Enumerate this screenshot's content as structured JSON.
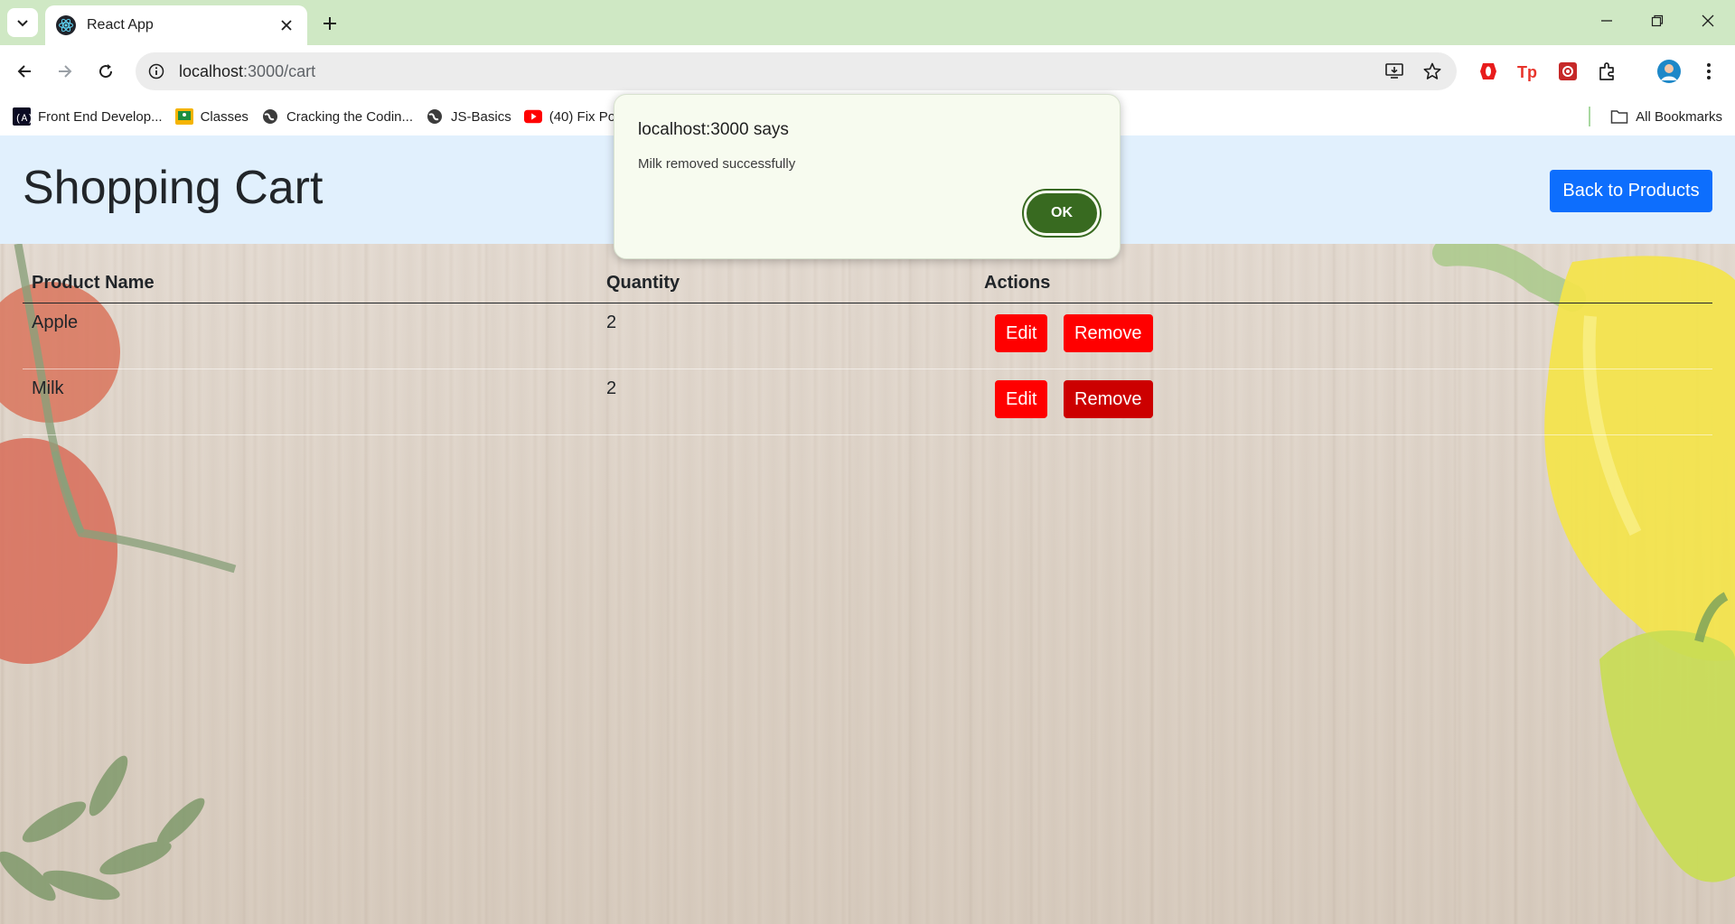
{
  "browser": {
    "tab_title": "React App",
    "url_host": "localhost",
    "url_path": ":3000/cart",
    "bookmarks": [
      {
        "label": "Front End Develop...",
        "icon": "freecodecamp-icon"
      },
      {
        "label": "Classes",
        "icon": "google-classroom-icon"
      },
      {
        "label": "Cracking the Codin...",
        "icon": "globe-icon"
      },
      {
        "label": "JS-Basics",
        "icon": "globe-icon"
      },
      {
        "label": "(40) Fix Po",
        "icon": "youtube-icon"
      }
    ],
    "all_bookmarks_label": "All Bookmarks",
    "accent_color": "#cfe8c4"
  },
  "page": {
    "title": "Shopping Cart",
    "back_button": "Back to Products",
    "table": {
      "headers": [
        "Product Name",
        "Quantity",
        "Actions"
      ],
      "rows": [
        {
          "name": "Apple",
          "quantity": "2",
          "edit_label": "Edit",
          "remove_label": "Remove"
        },
        {
          "name": "Milk",
          "quantity": "2",
          "edit_label": "Edit",
          "remove_label": "Remove"
        }
      ]
    },
    "colors": {
      "header_bg": "#e1f0fd",
      "primary": "#0d6efd",
      "danger": "#ff0000"
    }
  },
  "dialog": {
    "title": "localhost:3000 says",
    "message": "Milk removed successfully",
    "ok_label": "OK",
    "ok_color": "#386a20"
  }
}
